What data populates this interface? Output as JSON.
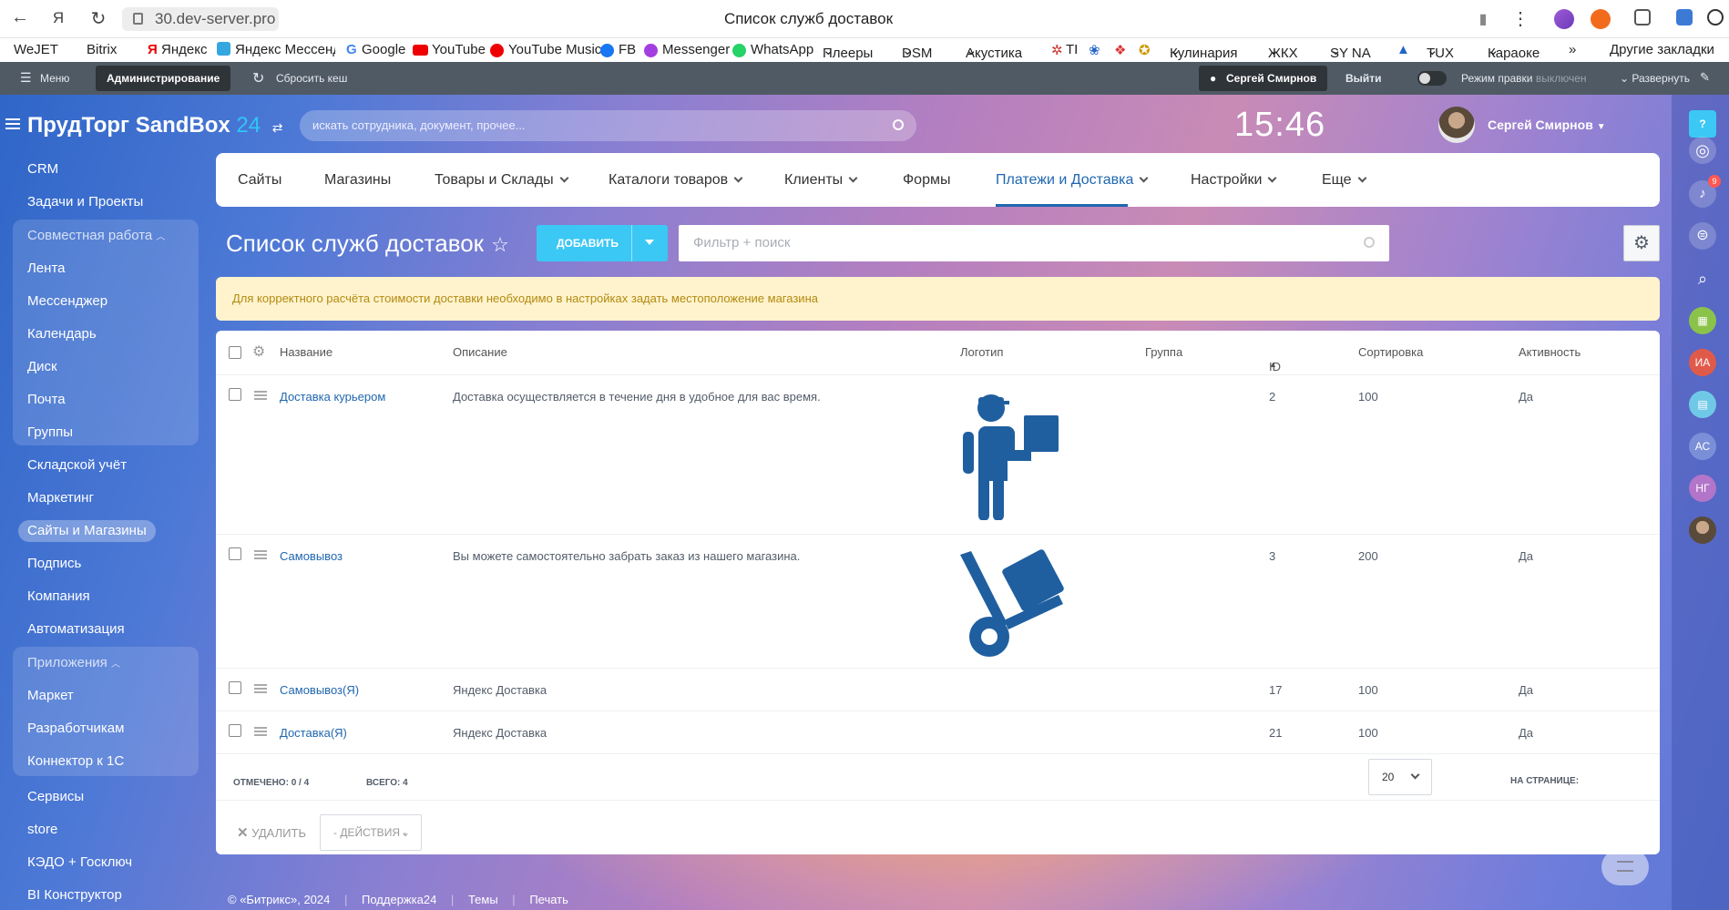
{
  "browser": {
    "url": "30.dev-server.pro",
    "title": "Список служб доставок"
  },
  "bookmarks": [
    "WeJET",
    "Bitrix",
    "Яндекс",
    "Яндекс Мессендж",
    "Google",
    "YouTube",
    "YouTube Music",
    "FB",
    "Messenger",
    "WhatsApp",
    "Плееры",
    "DSM",
    "Акустика",
    "TI",
    "Кулинария",
    "ЖКХ",
    "SY NA",
    "TUX",
    "Караоке",
    "Другие закладки"
  ],
  "admin_bar": {
    "menu": "Меню",
    "admin": "Администрирование",
    "clear_cache": "Сбросить кеш",
    "user": "Сергей Смирнов",
    "logout": "Выйти",
    "edit_mode": "Режим правки",
    "edit_mode_state": "выключен",
    "expand": "Развернуть"
  },
  "header": {
    "portal_name": "ПрудТорг SandBox",
    "portal_suffix": "24",
    "search_placeholder": "искать сотрудника, документ, прочее...",
    "time": "15:46",
    "user_name": "Сергей Смирнов"
  },
  "sidebar": {
    "items": [
      "CRM",
      "Задачи и Проекты"
    ],
    "group1_title": "Совместная работа",
    "group1": [
      "Лента",
      "Мессенджер",
      "Календарь",
      "Диск",
      "Почта",
      "Группы"
    ],
    "items2": [
      "Складской учёт",
      "Маркетинг",
      "Сайты и Магазины",
      "Подпись",
      "Компания",
      "Автоматизация"
    ],
    "group2_title": "Приложения",
    "group2": [
      "Маркет",
      "Разработчикам",
      "Коннектор к 1С"
    ],
    "items3": [
      "Сервисы",
      "store",
      "КЭДО + Госключ",
      "BI Конструктор"
    ]
  },
  "right_bar": {
    "badge_count": "9",
    "avatars": [
      "ИА",
      "АС",
      "НГ"
    ]
  },
  "tabs": [
    "Сайты",
    "Магазины",
    "Товары и Склады",
    "Каталоги товаров",
    "Клиенты",
    "Формы",
    "Платежи и Доставка",
    "Настройки",
    "Еще"
  ],
  "page": {
    "title": "Список служб доставок",
    "add_button": "ДОБАВИТЬ",
    "filter_placeholder": "Фильтр + поиск",
    "alert": "Для корректного расчёта стоимости доставки необходимо в настройках задать местоположение магазина"
  },
  "grid": {
    "columns": [
      "Название",
      "Описание",
      "Логотип",
      "Группа",
      "ID",
      "Сортировка",
      "Активность"
    ],
    "rows": [
      {
        "name": "Доставка курьером",
        "description": "Доставка осуществляется в течение дня в удобное для вас время.",
        "logo": "courier-icon",
        "group": "",
        "id": "2",
        "sort": "100",
        "active": "Да"
      },
      {
        "name": "Самовывоз",
        "description": "Вы можете самостоятельно забрать заказ из нашего магазина.",
        "logo": "hand-truck-icon",
        "group": "",
        "id": "3",
        "sort": "200",
        "active": "Да"
      },
      {
        "name": "Самовывоз(Я)",
        "description": "Яндекс Доставка",
        "logo": "",
        "group": "",
        "id": "17",
        "sort": "100",
        "active": "Да"
      },
      {
        "name": "Доставка(Я)",
        "description": "Яндекс Доставка",
        "logo": "",
        "group": "",
        "id": "21",
        "sort": "100",
        "active": "Да"
      }
    ],
    "selected_label": "ОТМЕЧЕНО: 0 / 4",
    "total_label": "ВСЕГО: 4",
    "per_page_label": "НА СТРАНИЦЕ:",
    "per_page_value": "20",
    "delete_label": "УДАЛИТЬ",
    "actions_label": "- ДЕЙСТВИЯ -"
  },
  "footer": [
    "© «Битрикс», 2024",
    "Поддержка24",
    "Темы",
    "Печать"
  ],
  "colors": {
    "accent": "#2067b0",
    "add_button": "#3bc8f5",
    "alert_bg": "#fef3cd",
    "icon_blue": "#1f5fa0"
  }
}
